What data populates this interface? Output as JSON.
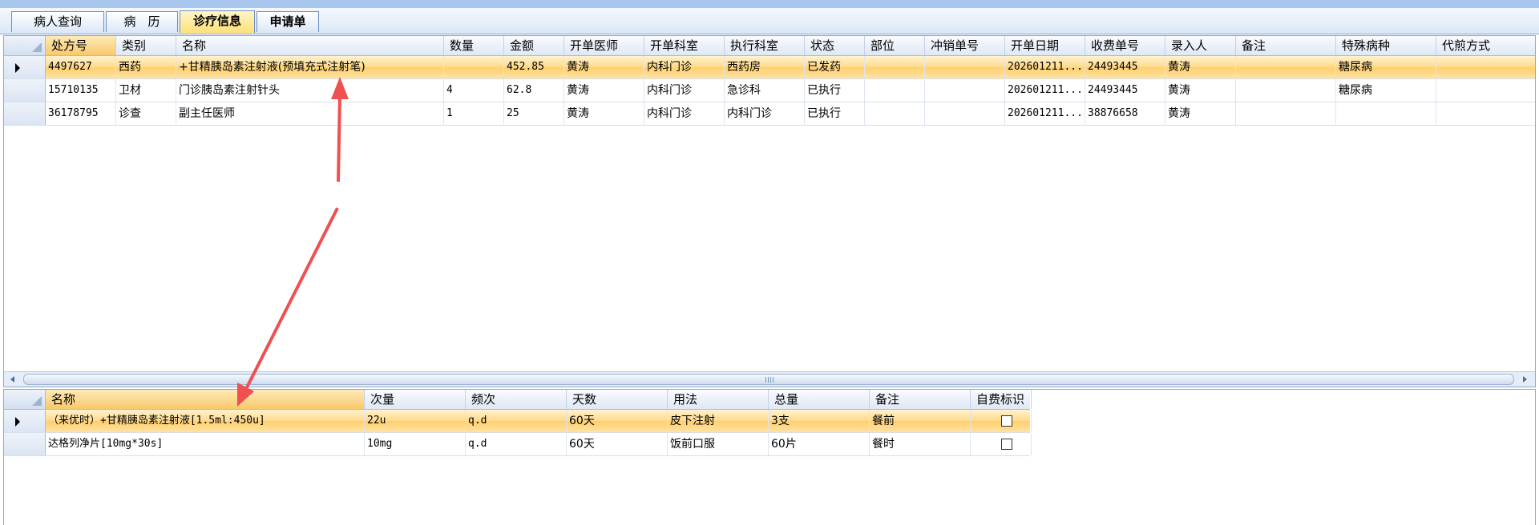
{
  "tabs": [
    {
      "label": "病人查询"
    },
    {
      "label": "病　历"
    },
    {
      "label": "诊疗信息"
    },
    {
      "label": "申请单"
    }
  ],
  "top_grid": {
    "columns": [
      "处方号",
      "类别",
      "名称",
      "数量",
      "金额",
      "开单医师",
      "开单科室",
      "执行科室",
      "状态",
      "部位",
      "冲销单号",
      "开单日期",
      "收费单号",
      "录入人",
      "备注",
      "特殊病种",
      "代煎方式"
    ],
    "rows": [
      [
        "4497627",
        "西药",
        "+甘精胰岛素注射液(预填充式注射笔)",
        "",
        "452.85",
        "黄涛",
        "内科门诊",
        "西药房",
        "已发药",
        "",
        "",
        "202601211...",
        "24493445",
        "黄涛",
        "",
        "糖尿病",
        ""
      ],
      [
        "15710135",
        "卫材",
        "门诊胰岛素注射针头",
        "4",
        "62.8",
        "黄涛",
        "内科门诊",
        "急诊科",
        "已执行",
        "",
        "",
        "202601211...",
        "24493445",
        "黄涛",
        "",
        "糖尿病",
        ""
      ],
      [
        "36178795",
        "诊查",
        "副主任医师",
        "1",
        "25",
        "黄涛",
        "内科门诊",
        "内科门诊",
        "已执行",
        "",
        "",
        "202601211...",
        "38876658",
        "黄涛",
        "",
        "",
        ""
      ]
    ],
    "selected_row": 0
  },
  "bottom_grid": {
    "columns": [
      "名称",
      "次量",
      "频次",
      "天数",
      "用法",
      "总量",
      "备注",
      "自费标识"
    ],
    "rows": [
      {
        "cells": [
          "（来优时）+甘精胰岛素注射液[1.5ml:450u]",
          "22u",
          "q.d",
          "60天",
          "皮下注射",
          "3支",
          "餐前"
        ],
        "self_pay": false
      },
      {
        "cells": [
          "达格列净片[10mg*30s]",
          "10mg",
          "q.d",
          "60天",
          "饭前口服",
          "60片",
          "餐时"
        ],
        "self_pay": false
      }
    ],
    "selected_row": 0
  },
  "annotation": {
    "color": "#f0504f"
  }
}
